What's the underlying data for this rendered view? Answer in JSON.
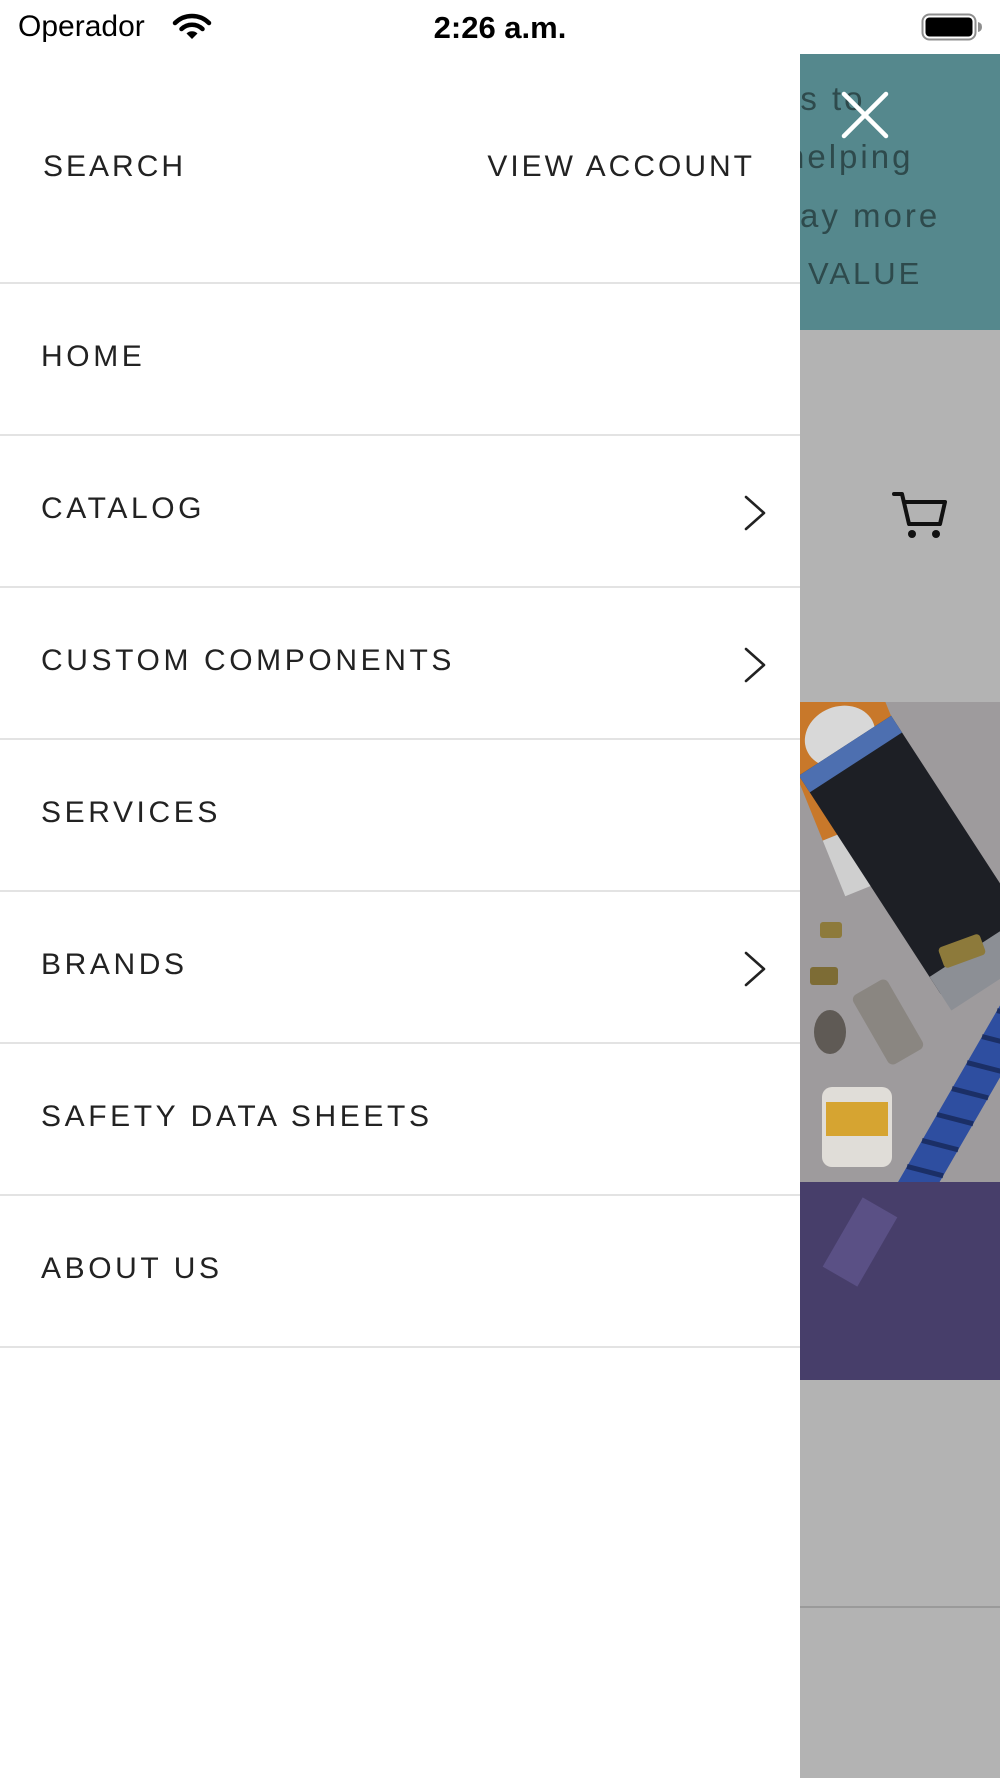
{
  "status_bar": {
    "carrier": "Operador",
    "time": "2:26 a.m."
  },
  "background": {
    "banner_lines": [
      "is to",
      "helping",
      "ay more",
      "VALUE"
    ],
    "colors": {
      "banner": "#55888d",
      "overlay": "#b3b3b3"
    }
  },
  "drawer": {
    "search_label": "SEARCH",
    "account_label": "VIEW ACCOUNT",
    "items": [
      {
        "label": "HOME",
        "has_submenu": false
      },
      {
        "label": "CATALOG",
        "has_submenu": true
      },
      {
        "label": "CUSTOM COMPONENTS",
        "has_submenu": true
      },
      {
        "label": "SERVICES",
        "has_submenu": false
      },
      {
        "label": "BRANDS",
        "has_submenu": true
      },
      {
        "label": "SAFETY DATA SHEETS",
        "has_submenu": false
      },
      {
        "label": "ABOUT US",
        "has_submenu": false
      }
    ]
  },
  "icons": {
    "wifi": "wifi-icon",
    "battery": "battery-icon",
    "close": "close-icon",
    "cart": "cart-icon",
    "chevron": "chevron-right-icon"
  }
}
